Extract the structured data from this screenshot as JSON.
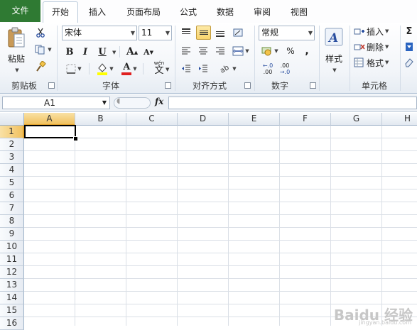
{
  "tabs": {
    "file": "文件",
    "items": [
      "开始",
      "插入",
      "页面布局",
      "公式",
      "数据",
      "审阅",
      "视图"
    ]
  },
  "clipboard": {
    "paste": "粘贴",
    "label": "剪贴板",
    "icons": [
      "paste-icon",
      "cut-icon",
      "copy-icon",
      "format-painter-icon"
    ]
  },
  "font": {
    "name": "宋体",
    "size": "11",
    "bold": "B",
    "italic": "I",
    "underline": "U",
    "grow": "A",
    "shrink": "A",
    "phonetic": "wén",
    "phonetic_char": "文",
    "font_color_letter": "A",
    "label": "字体",
    "fill_color": "#ffff00",
    "font_color": "#e02020"
  },
  "alignment": {
    "label": "对齐方式"
  },
  "number": {
    "format": "常规",
    "percent": "%",
    "comma": ",",
    "inc_decimal": ".00",
    "dec_decimal": ".0",
    "label": "数字"
  },
  "styles": {
    "label": "样式"
  },
  "cells": {
    "insert": "插入",
    "delete": "删除",
    "format": "格式",
    "label": "单元格"
  },
  "editing": {
    "sum": "Σ"
  },
  "formula_bar": {
    "name_box": "A1",
    "fx": "fx",
    "value": ""
  },
  "grid": {
    "columns": [
      "A",
      "B",
      "C",
      "D",
      "E",
      "F",
      "G",
      "H"
    ],
    "rows": [
      "1",
      "2",
      "3",
      "4",
      "5",
      "6",
      "7",
      "8",
      "9",
      "10",
      "11",
      "12",
      "13",
      "14",
      "15",
      "16"
    ],
    "active_cell": "A1"
  },
  "watermark": {
    "brand": "Baidu 经验",
    "url": "jingyan.baidu.com"
  }
}
